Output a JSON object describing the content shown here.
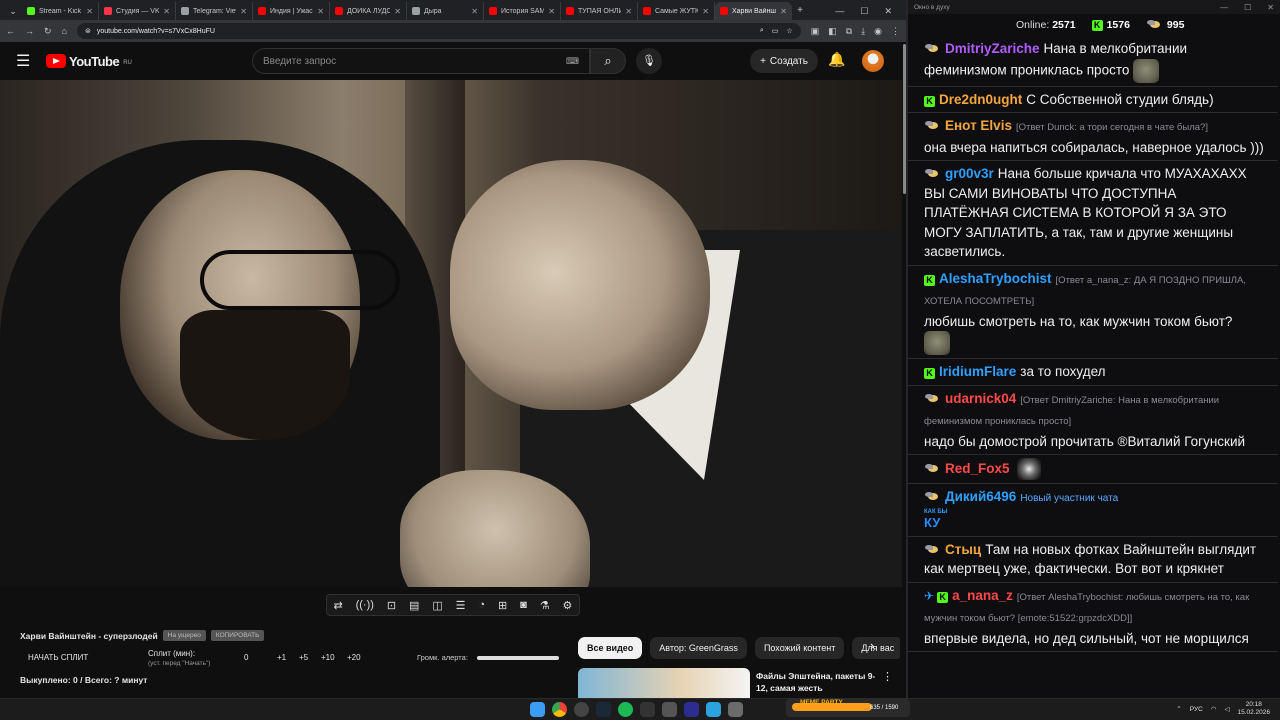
{
  "browser": {
    "tabs": [
      {
        "title": "Stream - Kick D",
        "color": "#53fc18"
      },
      {
        "title": "Студия — VK Ви",
        "color": "#ff3347"
      },
      {
        "title": "Telegram: View",
        "color": "#9aa0a6"
      },
      {
        "title": "Индия | Ужасны",
        "color": "#ff0000"
      },
      {
        "title": "ДОЙКА ЛУДОМА",
        "color": "#ff0000"
      },
      {
        "title": "Дыра",
        "color": "#9aa0a6"
      },
      {
        "title": "История SAMSU",
        "color": "#ff0000"
      },
      {
        "title": "ТУПАЯ ОНЛИ",
        "color": "#ff0000"
      },
      {
        "title": "Самые ЖУТКИЕ",
        "color": "#ff0000"
      },
      {
        "title": "Харви Вайнш",
        "color": "#ff0000",
        "active": true
      }
    ],
    "url": "youtube.com/watch?v=s7VxCx8HuFU"
  },
  "youtube": {
    "logo_text": "YouTube",
    "region": "RU",
    "search_placeholder": "Введите запрос",
    "create_label": "Создать"
  },
  "split": {
    "video_title": "Харви Вайнштейн - суперзлодей",
    "pill_1": "На ущерео",
    "pill_2": "КОПИРОВАТЬ",
    "start_label": "НАЧАТЬ СПЛИТ",
    "minutes_label": "Сплит (мин):",
    "minutes_hint": "(уст. перед \"Начать\")",
    "increments": [
      "0",
      "+1",
      "+5",
      "+10",
      "+20"
    ],
    "alert_label": "Громк. алерта:",
    "alert_volume": 1.0,
    "bought_label": "Выкуплено: 0 / Всего: ? минут"
  },
  "chips": [
    "Все видео",
    "Автор: GreenGrass",
    "Похожий контент",
    "Для вас"
  ],
  "recommendation": {
    "title": "Файлы Эпштейна, пакеты 9-12, самая жесть"
  },
  "chat": {
    "window_title": "Окно в духу",
    "online_label": "Online:",
    "online_count": "2571",
    "kick_count": "1576",
    "bee_count": "995",
    "messages": [
      {
        "nick": "DmitriyZariche",
        "color": "#b15cff",
        "badge": "bee",
        "text": "Нана в мелкобритании феминизмом прониклась просто",
        "emote": true
      },
      {
        "nick": "Dre2dn0ught",
        "color": "#f4a640",
        "badge": "kick",
        "text": "С Собственной студии блядь)"
      },
      {
        "nick": "Енот Elvis",
        "color": "#f4a640",
        "badge": "bee",
        "reply": "[Ответ Dunck: а тори сегодня в чате была?]",
        "text": "она вчера напиться собиралась, наверное удалось )))"
      },
      {
        "nick": "gr00v3r",
        "color": "#2fa0ff",
        "badge": "bee",
        "text": "Нана больше кричала что МУАХАХАХХ ВЫ САМИ ВИНОВАТЫ ЧТО ДОСТУПНА ПЛАТЁЖНАЯ СИСТЕМА В КОТОРОЙ Я ЗА ЭТО МОГУ ЗАПЛАТИТЬ, а так, там и другие женщины засветились."
      },
      {
        "nick": "AleshaTrybochist",
        "color": "#2fa0ff",
        "badge": "kick",
        "reply": "[Ответ a_nana_z: ДА Я ПОЗДНО ПРИШЛА, ХОТЕЛА ПОСОМТРЕТЬ]",
        "text": "любишь смотреть на то, как мужчин током бьют?",
        "emote_below": true
      },
      {
        "nick": "IridiumFlare",
        "color": "#2fa0ff",
        "badge": "kick",
        "text": "за то похудел"
      },
      {
        "nick": "udarnick04",
        "color": "#ff4a4a",
        "badge": "bee",
        "reply": "[Ответ DmitriyZariche: Нана в мелкобритании феминизмом прониклась просто]",
        "text": "надо бы домострой прочитать ®Виталий Гогунский"
      },
      {
        "nick": "Red_Fox5",
        "color": "#ff4a4a",
        "badge": "bee",
        "text": "",
        "emote_dog": true
      },
      {
        "nick": "Дикий6496",
        "color": "#2fa0ff",
        "badge": "bee",
        "newbie": "Новый участник чата",
        "kakby": {
          "top": "КАК БЫ",
          "big": "КУ"
        }
      },
      {
        "nick": "Стыц",
        "color": "#f4a640",
        "badge": "bee",
        "text": "Там на новых фотках Вайнштейн выглядит как мертвец уже, фактически. Вот вот и крякнет"
      },
      {
        "nick": "a_nana_z",
        "color": "#ff4a4a",
        "badge": "pin-kick",
        "reply": "[Ответ AleshaTrybochist: любишь смотреть на то, как мужчин током бьют? [emote:51522:grpzdcXDD]]",
        "text": "впервые видела, но дед сильный, чот не морщился"
      }
    ]
  },
  "taskbar": {
    "meme_title": "MEME PARTY",
    "meme_count": "635 / 1590",
    "lang": "РУС",
    "time": "20:18",
    "date": "15.02.2026"
  }
}
